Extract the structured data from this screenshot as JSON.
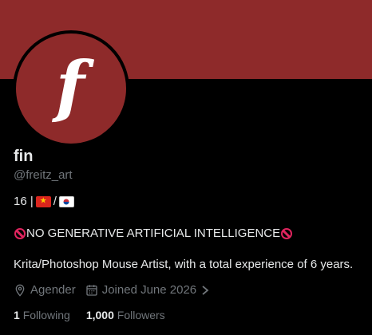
{
  "profile": {
    "banner_color": "#8e2a2a",
    "avatar_letter": "f",
    "display_name": "fin",
    "handle": "@freitz_art",
    "bio_line1_prefix": "16 | ",
    "bio_line1_sep": "/",
    "flags": [
      "vietnam-flag",
      "south-korea-flag"
    ],
    "no_ai_text": "NO GENERATIVE ARTIFICIAL INTELLIGENCE",
    "bio_line3": "Krita/Photoshop Mouse Artist, with a total experience of 6 years.",
    "location": "Agender",
    "joined": "Joined June 2026",
    "following_count": "1",
    "following_label": "Following",
    "followers_count": "1,000",
    "followers_label": "Followers"
  },
  "icons": {
    "location": "location-pin-icon",
    "calendar": "calendar-icon",
    "chevron": "chevron-right-icon",
    "prohibit": "prohibited-icon"
  },
  "colors": {
    "accent": "#8e2a2a",
    "muted_text": "#71767b",
    "primary_text": "#e7e9ea",
    "prohibit_red": "#e0245e"
  }
}
